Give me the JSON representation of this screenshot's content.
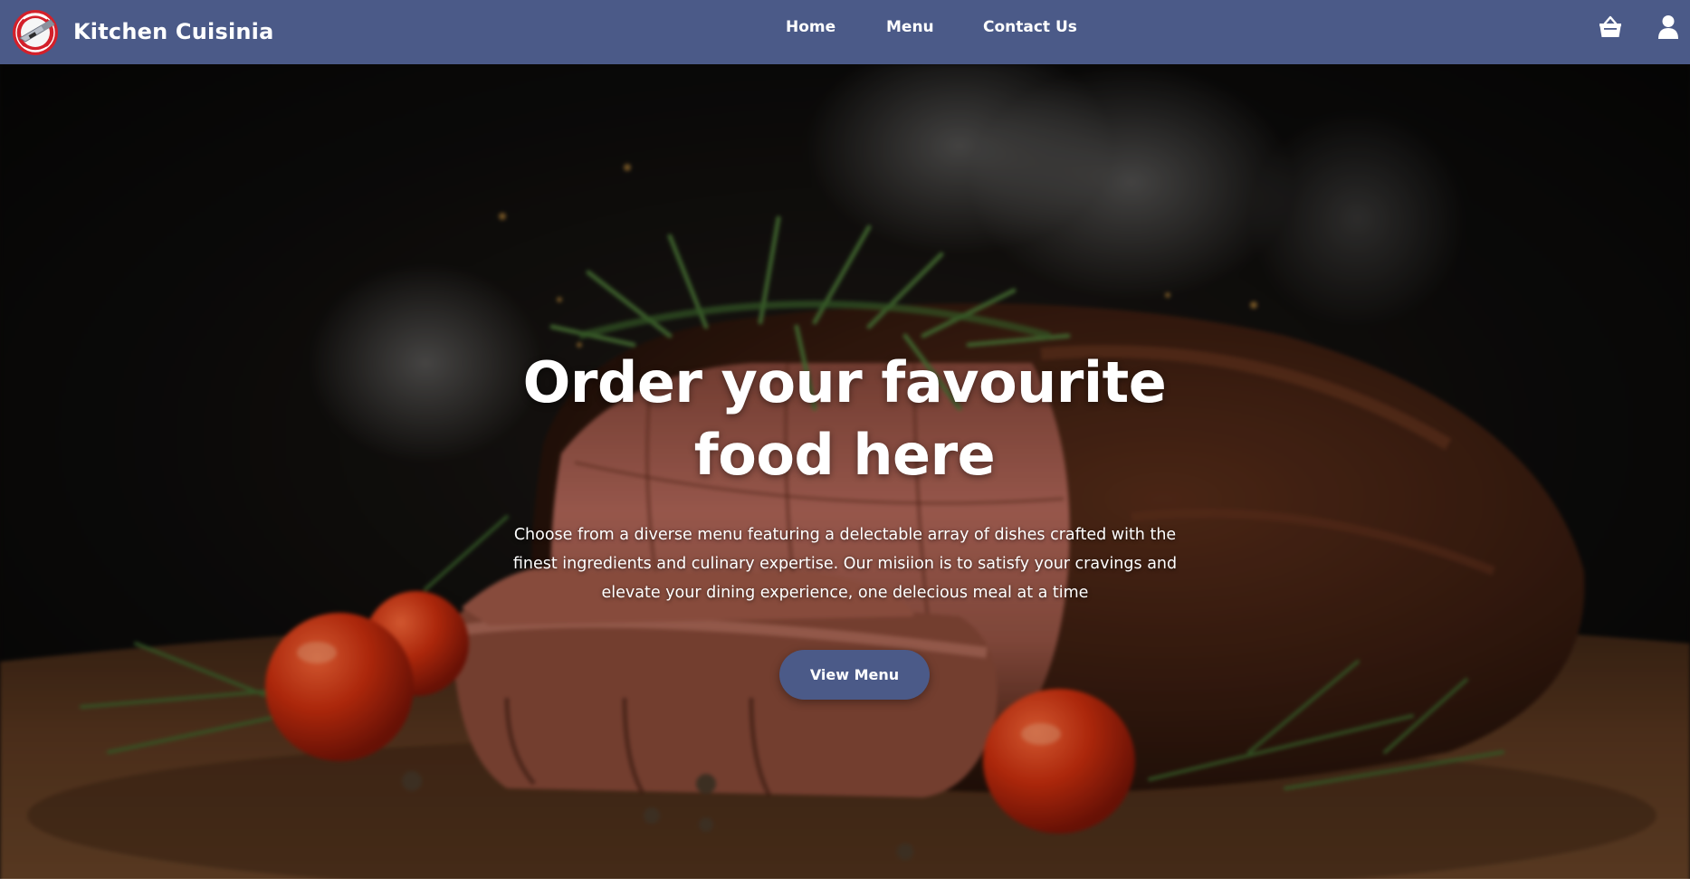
{
  "nav": {
    "brand": "Kitchen Cuisinia",
    "logo_icon": "chef-knife-logo-icon",
    "links": [
      "Home",
      "Menu",
      "Contact Us"
    ],
    "icons": [
      "basket-icon",
      "user-icon"
    ],
    "background": "#4b5a88"
  },
  "hero": {
    "title": "Order your favourite food here",
    "description": "Choose from a diverse menu featuring a delectable array of dishes crafted with the finest ingredients and culinary expertise. Our misiion is to satisfy your cravings and elevate your dining experience, one delecious meal at a time",
    "cta_label": "View Menu",
    "cta_color": "#4b5a88",
    "background_image": "roast-beef-with-rosemary-and-tomatoes"
  }
}
